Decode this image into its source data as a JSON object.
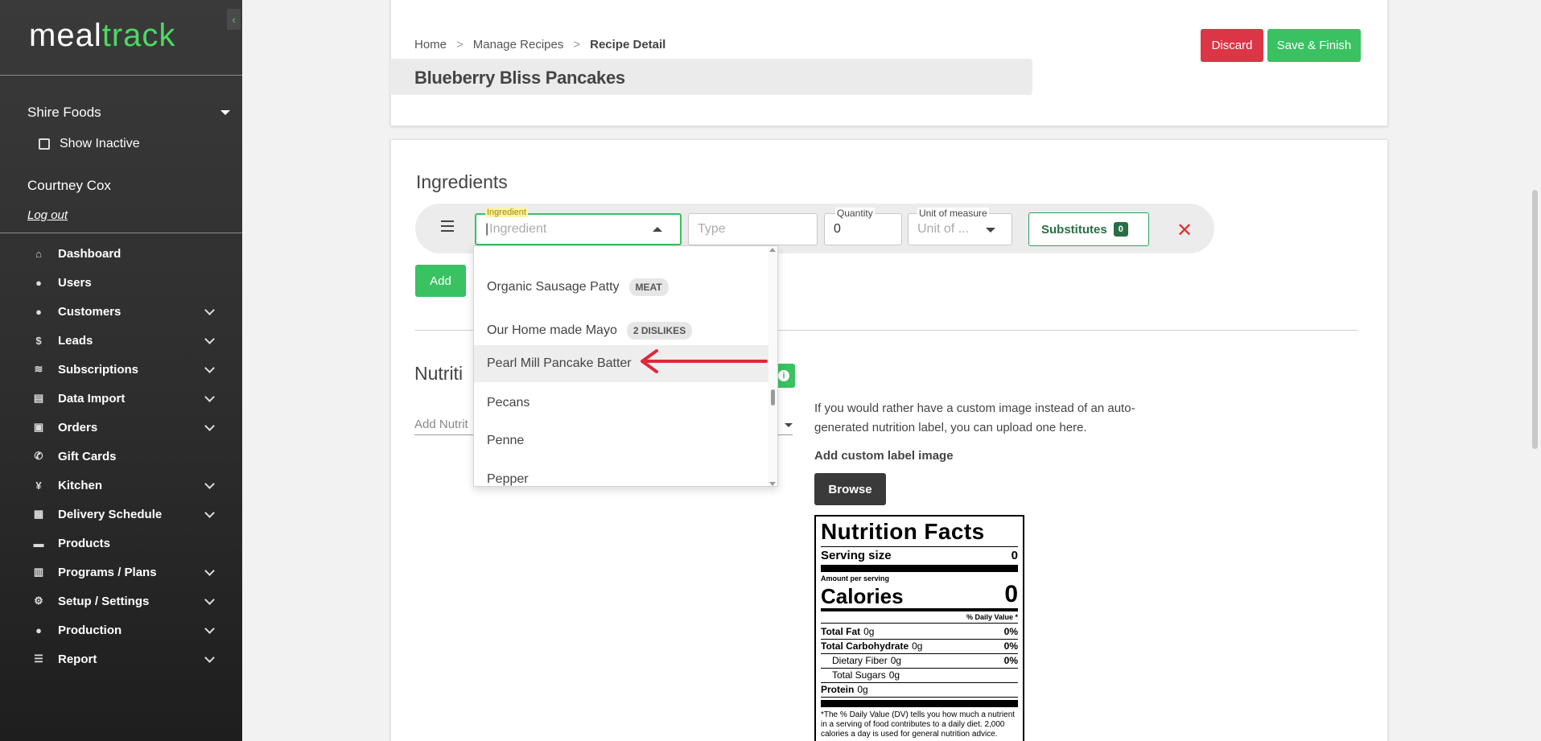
{
  "app": {
    "logo_main": "meal",
    "logo_accent": "track",
    "accent_color": "#4cd964"
  },
  "sidebar": {
    "collapse_icon": "‹",
    "org": "Shire Foods",
    "show_inactive": "Show Inactive",
    "user_name": "Courtney Cox",
    "logout": "Log out",
    "items": [
      {
        "label": "Dashboard",
        "icon": "home-icon",
        "glyph": "⌂",
        "has_children": false
      },
      {
        "label": "Users",
        "icon": "user-icon",
        "glyph": "●",
        "has_children": false
      },
      {
        "label": "Customers",
        "icon": "customers-icon",
        "glyph": "●",
        "has_children": true
      },
      {
        "label": "Leads",
        "icon": "dollar-icon",
        "glyph": "$",
        "has_children": true
      },
      {
        "label": "Subscriptions",
        "icon": "layers-icon",
        "glyph": "≋",
        "has_children": true
      },
      {
        "label": "Data Import",
        "icon": "file-icon",
        "glyph": "▤",
        "has_children": true
      },
      {
        "label": "Orders",
        "icon": "bag-icon",
        "glyph": "▣",
        "has_children": true
      },
      {
        "label": "Gift Cards",
        "icon": "phone-icon",
        "glyph": "✆",
        "has_children": false
      },
      {
        "label": "Kitchen",
        "icon": "utensils-icon",
        "glyph": "¥",
        "has_children": true
      },
      {
        "label": "Delivery Schedule",
        "icon": "calendar-icon",
        "glyph": "▦",
        "has_children": true
      },
      {
        "label": "Products",
        "icon": "box-icon",
        "glyph": "▬",
        "has_children": false
      },
      {
        "label": "Programs / Plans",
        "icon": "clipboard-icon",
        "glyph": "▥",
        "has_children": true
      },
      {
        "label": "Setup / Settings",
        "icon": "gear-icon",
        "glyph": "⚙",
        "has_children": true
      },
      {
        "label": "Production",
        "icon": "user-tie-icon",
        "glyph": "●",
        "has_children": true
      },
      {
        "label": "Report",
        "icon": "list-icon",
        "glyph": "☰",
        "has_children": true
      }
    ]
  },
  "header": {
    "breadcrumb": [
      "Home",
      "Manage Recipes",
      "Recipe Detail"
    ],
    "breadcrumb_sep": ">",
    "recipe_title": "Blueberry Bliss Pancakes",
    "discard": "Discard",
    "save_finish": "Save & Finish"
  },
  "ingredients": {
    "title": "Ingredients",
    "ingredient_label": "Ingredient",
    "ingredient_placeholder": "Ingredient",
    "type_placeholder": "Type",
    "quantity_label": "Quantity",
    "quantity_value": "0",
    "unit_label": "Unit of measure",
    "unit_placeholder": "Unit of ...",
    "substitutes": "Substitutes",
    "substitutes_count": "0",
    "add": "Add",
    "close": "✕"
  },
  "dropdown": {
    "options": [
      {
        "label": "Organic Sausage Patty",
        "tag": "MEAT"
      },
      {
        "label": "Our Home made Mayo",
        "tag": "2 DISLIKES"
      },
      {
        "label": "Pearl Mill Pancake Batter",
        "tag": "",
        "highlighted": true
      },
      {
        "label": "Pecans",
        "tag": ""
      },
      {
        "label": "Penne",
        "tag": ""
      },
      {
        "label": "Pepper",
        "tag": ""
      }
    ]
  },
  "nutrition": {
    "title_visible": "Nutriti",
    "add_nutrition_placeholder": "Add Nutrit",
    "info_icon": "i",
    "custom_text": "If you would rather have a custom image instead of an auto-generated nutrition label, you can upload one here.",
    "add_custom_label": "Add custom label image",
    "browse": "Browse",
    "label": {
      "title": "Nutrition Facts",
      "serving_size": "Serving size",
      "serving_value": "0",
      "amount_per_serving": "Amount per serving",
      "calories": "Calories",
      "calories_value": "0",
      "dv_header": "% Daily Value *",
      "rows": [
        {
          "name": "Total Fat",
          "amount": "0g",
          "dv": "0%",
          "bold": true,
          "indent": 0
        },
        {
          "name": "Total Carbohydrate",
          "amount": "0g",
          "dv": "0%",
          "bold": true,
          "indent": 0
        },
        {
          "name": "Dietary Fiber",
          "amount": "0g",
          "dv": "0%",
          "bold": false,
          "indent": 1
        },
        {
          "name": "Total Sugars",
          "amount": "0g",
          "dv": "",
          "bold": false,
          "indent": 1
        },
        {
          "name": "Protein",
          "amount": "0g",
          "dv": "",
          "bold": true,
          "indent": 0
        }
      ],
      "footnote": "*The % Daily Value (DV) tells you how much a nutrient in a serving of food contributes to a daily diet. 2,000 calories a day is used for general nutrition advice."
    }
  }
}
